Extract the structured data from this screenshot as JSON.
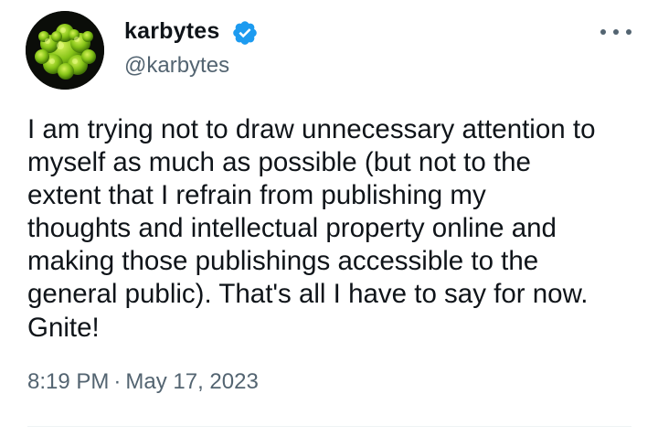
{
  "tweet": {
    "author": {
      "display_name": "karbytes",
      "handle": "@karbytes",
      "verified": true,
      "verified_color": "#1d9bf0"
    },
    "more_icon": "more-horizontal-icon",
    "text": "I am trying not to draw unnecessary attention to\nmyself as much as possible (but not to the\nextent that I refrain from publishing my\nthoughts and intellectual property online and\nmaking those publishings accessible to the\ngeneral public). That's all I have to say for now.\nGnite!",
    "time": "8:19 PM",
    "separator": "·",
    "date": "May 17, 2023"
  },
  "colors": {
    "text": "#0f1419",
    "secondary": "#536471",
    "divider": "#eff3f4"
  }
}
